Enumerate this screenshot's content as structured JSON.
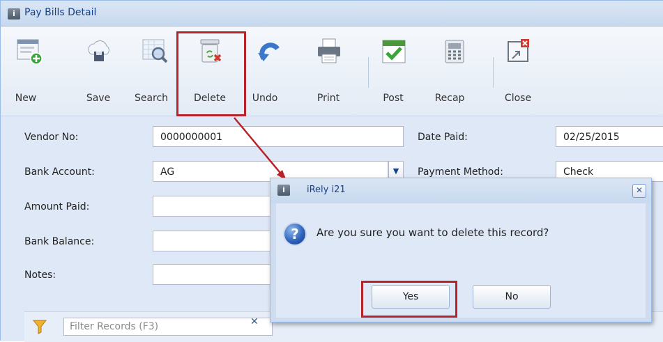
{
  "window": {
    "title": "Pay Bills Detail"
  },
  "toolbar": {
    "new": "New",
    "save": "Save",
    "search": "Search",
    "delete": "Delete",
    "undo": "Undo",
    "print": "Print",
    "post": "Post",
    "recap": "Recap",
    "close": "Close"
  },
  "form": {
    "vendor_label": "Vendor No:",
    "vendor_value": "0000000001",
    "bank_account_label": "Bank Account:",
    "bank_account_value": "AG",
    "amount_paid_label": "Amount Paid:",
    "amount_paid_value": "",
    "bank_balance_label": "Bank Balance:",
    "bank_balance_value": "",
    "notes_label": "Notes:",
    "notes_value": "",
    "date_paid_label": "Date Paid:",
    "date_paid_value": "02/25/2015",
    "payment_method_label": "Payment Method:",
    "payment_method_value": "Check"
  },
  "filter": {
    "placeholder": "Filter Records (F3)"
  },
  "dialog": {
    "title": "iRely i21",
    "message": "Are you sure you want to delete this record?",
    "yes": "Yes",
    "no": "No"
  },
  "colors": {
    "highlight": "#b8232a",
    "accent": "#15428b"
  },
  "icons": [
    "new-icon",
    "save-icon",
    "search-icon",
    "delete-icon",
    "undo-icon",
    "print-icon",
    "post-icon",
    "recap-icon",
    "close-icon",
    "question-icon",
    "filter-icon"
  ]
}
